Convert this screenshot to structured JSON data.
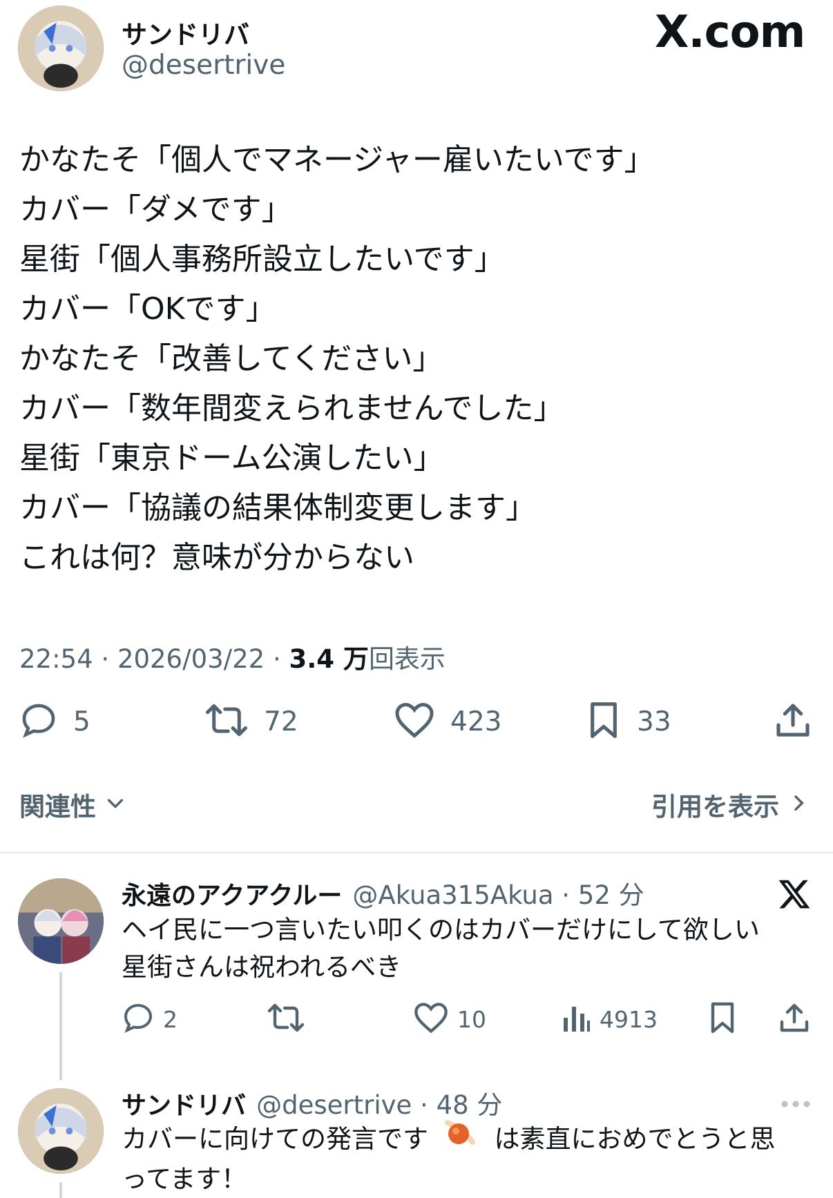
{
  "header": {
    "display_name": "サンドリバ",
    "handle": "@desertrive",
    "site_logo": "X.com"
  },
  "tweet": {
    "lines": [
      "かなたそ「個人でマネージャー雇いたいです」",
      "カバー「ダメです」",
      "星街「個人事務所設立したいです」",
      "カバー「OKです」",
      "かなたそ「改善してください」",
      "カバー「数年間変えられませんでした」",
      "星街「東京ドーム公演したい」",
      "カバー「協議の結果体制変更します」",
      "これは何？意味が分からない"
    ],
    "time": "22:54",
    "date": "2026/03/22",
    "views_count": "3.4 万",
    "views_label": "回表示",
    "stats": {
      "replies": "5",
      "retweets": "72",
      "likes": "423",
      "bookmarks": "33"
    }
  },
  "sort": {
    "label": "関連性",
    "quotes_link": "引用を表示"
  },
  "replies": [
    {
      "name": "永遠のアクアクルー",
      "handle": "@Akua315Akua",
      "time": "52 分",
      "lines": [
        "ヘイ民に一つ言いたい叩くのはカバーだけにして欲しい",
        "星街さんは祝われるべき"
      ],
      "stats": {
        "replies": "2",
        "likes": "10",
        "views": "4913"
      }
    },
    {
      "name": "サンドリバ",
      "handle": "@desertrive",
      "time": "48 分",
      "line1_before": "カバーに向けての発言です",
      "line1_after": "は素直におめでとうと思",
      "line2": "ってます！"
    }
  ],
  "icons": {
    "reply": "reply-icon",
    "retweet": "retweet-icon",
    "like": "heart-icon",
    "bookmark": "bookmark-icon",
    "share": "share-icon",
    "views": "views-icon",
    "more": "more-icon",
    "x_logo": "x-logo-icon",
    "comet_emoji": "comet-emoji-icon"
  }
}
